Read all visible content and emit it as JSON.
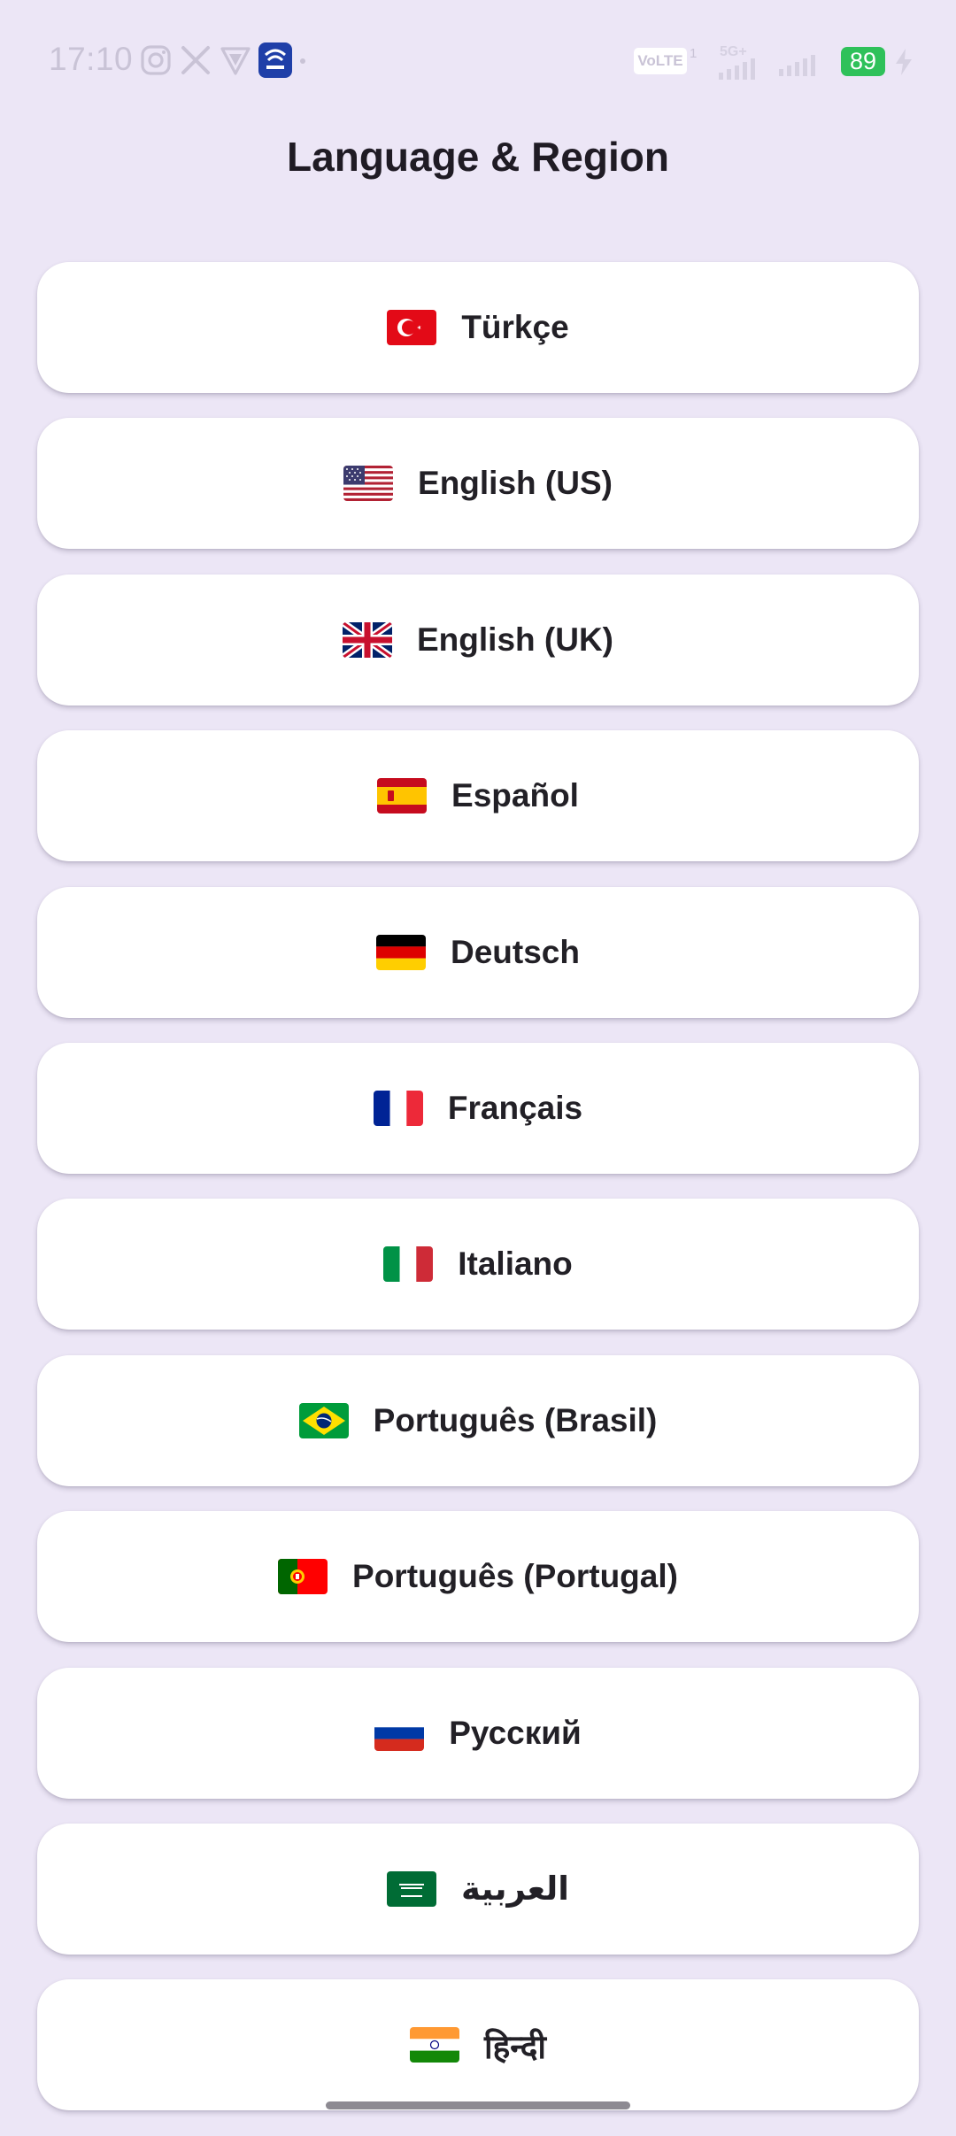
{
  "status_bar": {
    "time": "17:10",
    "volte": "VoLTE",
    "sim_slot": "1",
    "network": "5G+",
    "battery": "89",
    "icons": [
      "instagram-icon",
      "x-icon",
      "vpn-icon",
      "app-icon",
      "wifi-signal-icon",
      "cell-signal-icon",
      "charging-icon"
    ]
  },
  "header": {
    "title": "Language & Region"
  },
  "languages": [
    {
      "label": "Türkçe",
      "flag": "flag-turkey"
    },
    {
      "label": "English (US)",
      "flag": "flag-usa"
    },
    {
      "label": "English (UK)",
      "flag": "flag-uk"
    },
    {
      "label": "Español",
      "flag": "flag-spain"
    },
    {
      "label": "Deutsch",
      "flag": "flag-germany"
    },
    {
      "label": "Français",
      "flag": "flag-france"
    },
    {
      "label": "Italiano",
      "flag": "flag-italy"
    },
    {
      "label": "Português (Brasil)",
      "flag": "flag-brazil"
    },
    {
      "label": "Português (Portugal)",
      "flag": "flag-portugal"
    },
    {
      "label": "Русский",
      "flag": "flag-russia"
    },
    {
      "label": "العربية",
      "flag": "flag-saudi-arabia"
    },
    {
      "label": "हिन्दी",
      "flag": "flag-india"
    }
  ],
  "colors": {
    "background": "#ece6f6",
    "card": "#ffffff",
    "text": "#222026",
    "battery": "#2fc15a"
  }
}
